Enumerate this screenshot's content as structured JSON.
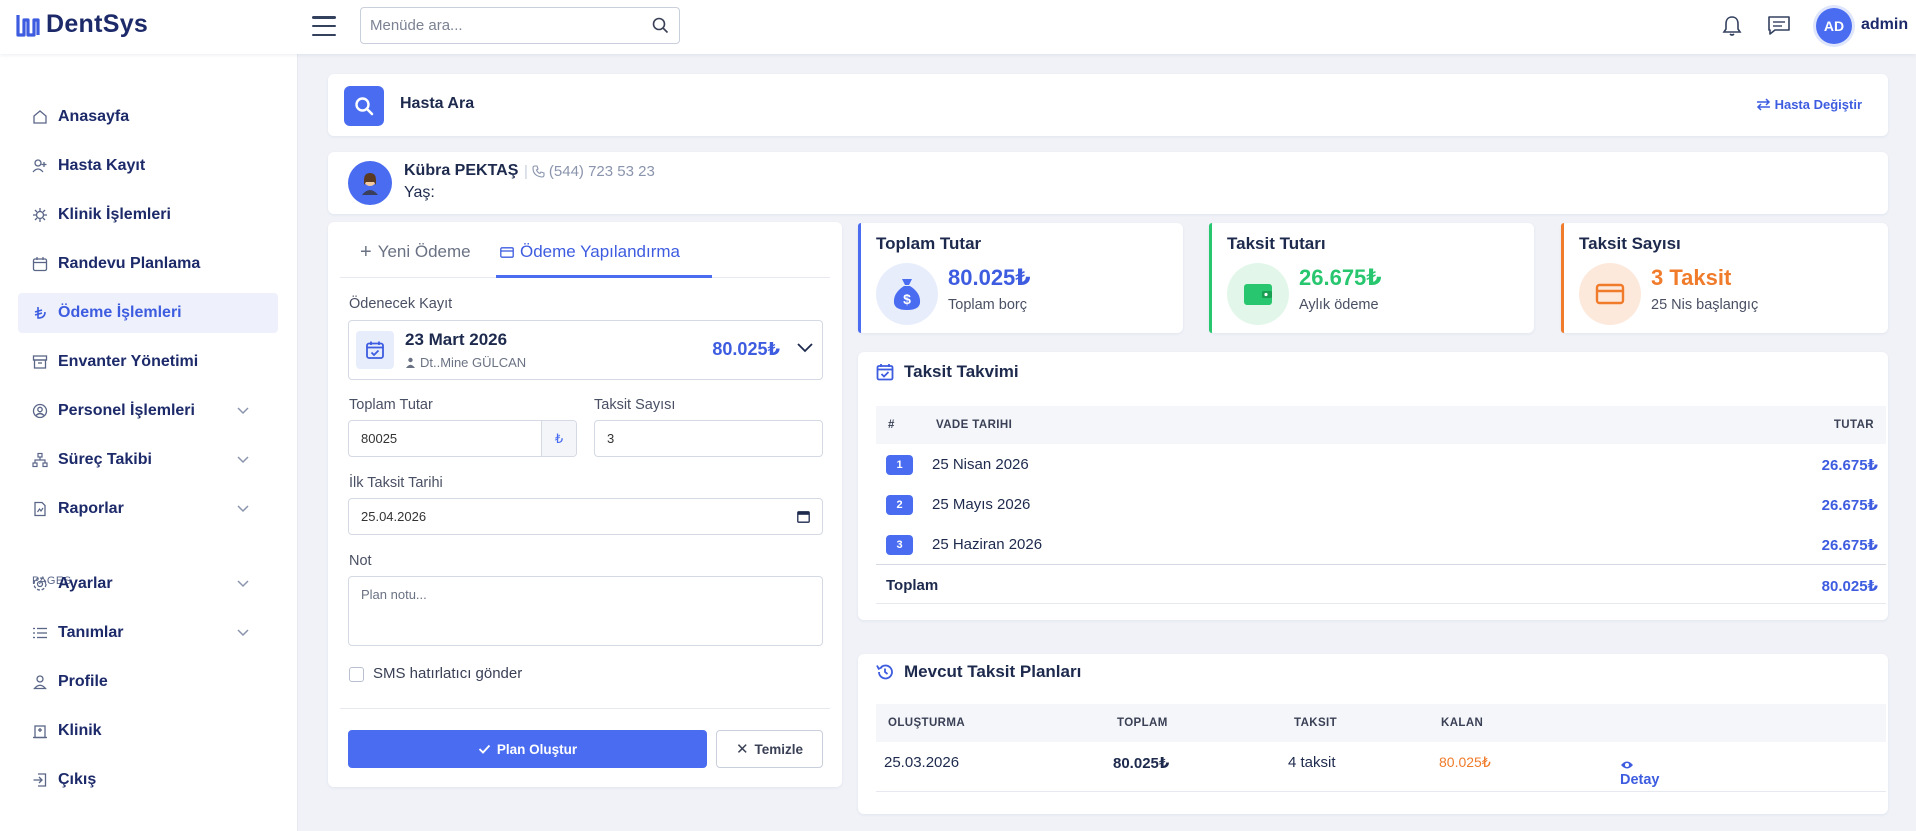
{
  "app": {
    "logo_text": "DentSys"
  },
  "topbar": {
    "search_placeholder": "Menüde ara...",
    "user_initials": "AD",
    "user_name": "admin"
  },
  "sidebar": {
    "items": [
      {
        "label": "Anasayfa",
        "icon": "home-icon"
      },
      {
        "label": "Hasta Kayıt",
        "icon": "user-plus-icon"
      },
      {
        "label": "Klinik İşlemleri",
        "icon": "virus-icon"
      },
      {
        "label": "Randevu Planlama",
        "icon": "calendar-icon"
      },
      {
        "label": "Ödeme İşlemleri",
        "icon": "lira-icon",
        "active": true
      },
      {
        "label": "Envanter Yönetimi",
        "icon": "archive-icon"
      },
      {
        "label": "Personel İşlemleri",
        "icon": "user-circle-icon",
        "expandable": true
      },
      {
        "label": "Süreç Takibi",
        "icon": "sitemap-icon",
        "expandable": true
      },
      {
        "label": "Raporlar",
        "icon": "file-chart-icon",
        "expandable": true
      }
    ],
    "section_label": "PAGES",
    "pages": [
      {
        "label": "Ayarlar",
        "icon": "gear-icon",
        "expandable": true
      },
      {
        "label": "Tanımlar",
        "icon": "list-icon",
        "expandable": true
      },
      {
        "label": "Profile",
        "icon": "user-icon"
      },
      {
        "label": "Klinik",
        "icon": "hospital-icon"
      },
      {
        "label": "Çıkış",
        "icon": "logout-icon"
      }
    ]
  },
  "search_header": {
    "title": "Hasta Ara",
    "change_label": "Hasta Değiştir"
  },
  "patient": {
    "name": "Kübra PEKTAŞ",
    "phone": "(544) 723 53 23",
    "age_label": "Yaş:"
  },
  "payment_form": {
    "tabs": [
      "Yeni Ödeme",
      "Ödeme Yapılandırma"
    ],
    "active_tab": "Ödeme Yapılandırma",
    "record_label": "Ödenecek Kayıt",
    "record": {
      "date": "23 Mart 2026",
      "doctor": "Dt..Mine GÜLCAN",
      "amount": "80.025₺"
    },
    "total_label": "Toplam Tutar",
    "total_value": "80025",
    "currency": "₺",
    "installment_count_label": "Taksit Sayısı",
    "installment_count_value": "3",
    "first_date_label": "İlk Taksit Tarihi",
    "first_date_value": "25.04.2026",
    "note_label": "Not",
    "note_placeholder": "Plan notu...",
    "sms_label": "SMS hatırlatıcı gönder",
    "sms_checked": false,
    "create_button": "Plan Oluştur",
    "clear_button": "Temizle"
  },
  "stats": [
    {
      "title": "Toplam Tutar",
      "value": "80.025₺",
      "sub": "Toplam borç",
      "color": "#4a6cf0",
      "bg": "#e8edfc",
      "icon": "money-bag-icon"
    },
    {
      "title": "Taksit Tutarı",
      "value": "26.675₺",
      "sub": "Aylık ödeme",
      "color": "#28c76f",
      "bg": "#e2f7ea",
      "icon": "wallet-icon"
    },
    {
      "title": "Taksit Sayısı",
      "value": "3 Taksit",
      "sub": "25 Nis başlangıç",
      "color": "#f07b2a",
      "bg": "#fde9dc",
      "icon": "credit-card-icon"
    }
  ],
  "schedule": {
    "title": "Taksit Takvimi",
    "columns": [
      "#",
      "VADE TARIHI",
      "TUTAR"
    ],
    "rows": [
      {
        "no": "1",
        "date": "25 Nisan 2026",
        "amount": "26.675₺"
      },
      {
        "no": "2",
        "date": "25 Mayıs 2026",
        "amount": "26.675₺"
      },
      {
        "no": "3",
        "date": "25 Haziran 2026",
        "amount": "26.675₺"
      }
    ],
    "total_label": "Toplam",
    "total_amount": "80.025₺"
  },
  "plans": {
    "title": "Mevcut Taksit Planları",
    "columns": [
      "OLUŞTURMA",
      "TOPLAM",
      "TAKSIT",
      "KALAN"
    ],
    "rows": [
      {
        "created": "25.03.2026",
        "total": "80.025₺",
        "installments": "4 taksit",
        "remaining": "80.025₺",
        "action": "Detay"
      }
    ]
  }
}
